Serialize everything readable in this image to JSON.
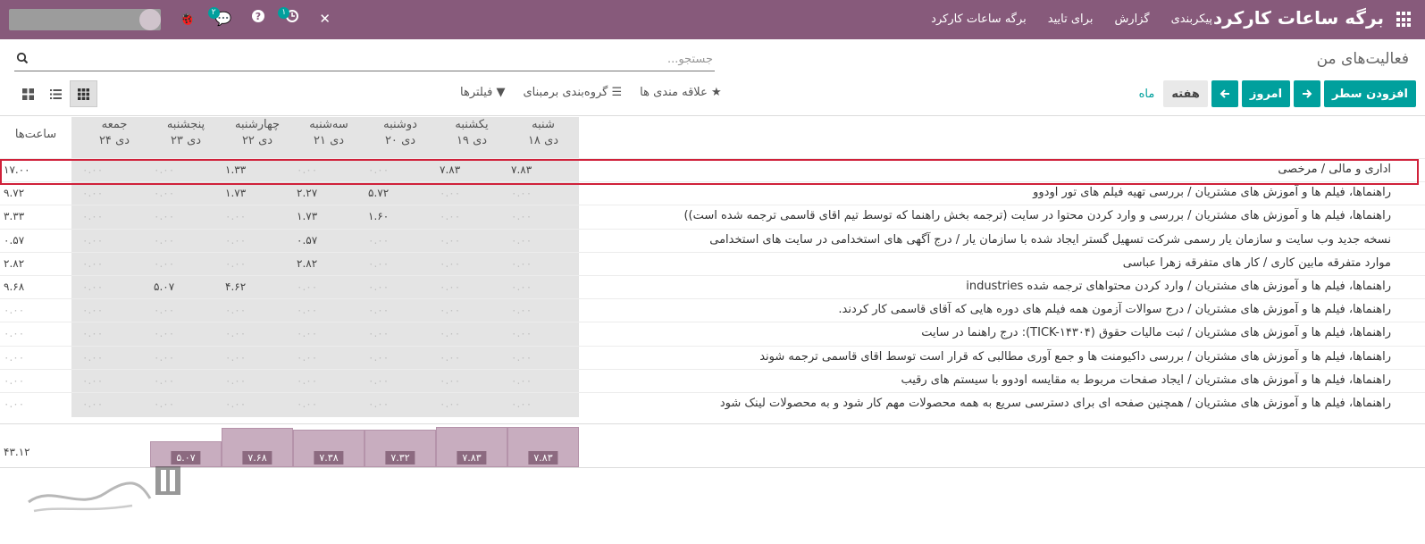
{
  "app": {
    "title": "برگه ساعات کارکرد",
    "menu": [
      "برگه ساعات کارکرد",
      "برای تایید",
      "گزارش",
      "پیکربندی"
    ],
    "systray": {
      "activity_badge": "۱",
      "messages_badge": "۲"
    }
  },
  "control": {
    "page_title": "فعالیت‌های من",
    "search_placeholder": "جستجو...",
    "buttons": {
      "add_line": "افزودن سطر",
      "today": "امروز",
      "week": "هفته",
      "month": "ماه"
    },
    "filters": {
      "filter": "فیلترها",
      "group_by": "گروه‌بندی برمبنای",
      "favorites": "علاقه مندی ها"
    }
  },
  "grid": {
    "hours_header": "ساعت‌ها",
    "days": [
      {
        "name": "شنبه",
        "date": "۱۸ دی"
      },
      {
        "name": "یکشنبه",
        "date": "۱۹ دی"
      },
      {
        "name": "دوشنبه",
        "date": "۲۰ دی"
      },
      {
        "name": "سه‌شنبه",
        "date": "۲۱ دی"
      },
      {
        "name": "چهارشنبه",
        "date": "۲۲ دی"
      },
      {
        "name": "پنجشنبه",
        "date": "۲۳ دی"
      },
      {
        "name": "جمعه",
        "date": "۲۴ دی"
      }
    ],
    "rows": [
      {
        "label": "اداری و مالی  /  مرخصی",
        "values": [
          "۷.۸۳",
          "۷.۸۳",
          "۰.۰۰",
          "۰.۰۰",
          "۱.۳۳",
          "۰.۰۰",
          "۰.۰۰"
        ],
        "total": "۱۷.۰۰"
      },
      {
        "label": "راهنماها، فیلم ها و آموزش های مشتریان  /  بررسی تهیه فیلم های تور اودوو",
        "values": [
          "۰.۰۰",
          "۰.۰۰",
          "۵.۷۲",
          "۲.۲۷",
          "۱.۷۳",
          "۰.۰۰",
          "۰.۰۰"
        ],
        "total": "۹.۷۲"
      },
      {
        "label": "راهنماها، فیلم ها و آموزش های مشتریان  /  بررسی و وارد کردن محتوا در سایت (ترجمه بخش راهنما که توسط تیم اقای قاسمی ترجمه شده است))",
        "values": [
          "۰.۰۰",
          "۰.۰۰",
          "۱.۶۰",
          "۱.۷۳",
          "۰.۰۰",
          "۰.۰۰",
          "۰.۰۰"
        ],
        "total": "۳.۳۳"
      },
      {
        "label": "نسخه جدید وب سایت و سازمان یار رسمی شرکت تسهیل گستر ایجاد شده با سازمان یار  /  درج آگهی های استخدامی در سایت های استخدامی",
        "values": [
          "۰.۰۰",
          "۰.۰۰",
          "۰.۰۰",
          "۰.۵۷",
          "۰.۰۰",
          "۰.۰۰",
          "۰.۰۰"
        ],
        "total": "۰.۵۷"
      },
      {
        "label": "موارد متفرقه مابین کاری  /  کار های متفرقه زهرا عباسی",
        "values": [
          "۰.۰۰",
          "۰.۰۰",
          "۰.۰۰",
          "۲.۸۲",
          "۰.۰۰",
          "۰.۰۰",
          "۰.۰۰"
        ],
        "total": "۲.۸۲"
      },
      {
        "label": "راهنماها، فیلم ها و آموزش های مشتریان  /  وارد کردن محتواهای ترجمه شده industries",
        "values": [
          "۰.۰۰",
          "۰.۰۰",
          "۰.۰۰",
          "۰.۰۰",
          "۴.۶۲",
          "۵.۰۷",
          "۰.۰۰"
        ],
        "total": "۹.۶۸"
      },
      {
        "label": "راهنماها، فیلم ها و آموزش های مشتریان  /  درج سوالات آزمون همه فیلم های دوره هایی که آقای قاسمی کار کردند.",
        "values": [
          "۰.۰۰",
          "۰.۰۰",
          "۰.۰۰",
          "۰.۰۰",
          "۰.۰۰",
          "۰.۰۰",
          "۰.۰۰"
        ],
        "total": "۰.۰۰"
      },
      {
        "label": "راهنماها، فیلم ها و آموزش های مشتریان  /  ثبت مالیات حقوق (TICK-۱۴۳۰۴): درج راهنما در سایت",
        "values": [
          "۰.۰۰",
          "۰.۰۰",
          "۰.۰۰",
          "۰.۰۰",
          "۰.۰۰",
          "۰.۰۰",
          "۰.۰۰"
        ],
        "total": "۰.۰۰"
      },
      {
        "label": "راهنماها، فیلم ها و آموزش های مشتریان  /  بررسی داکیومنت ها و جمع آوری مطالبی که قرار است توسط اقای قاسمی ترجمه شوند",
        "values": [
          "۰.۰۰",
          "۰.۰۰",
          "۰.۰۰",
          "۰.۰۰",
          "۰.۰۰",
          "۰.۰۰",
          "۰.۰۰"
        ],
        "total": "۰.۰۰"
      },
      {
        "label": "راهنماها، فیلم ها و آموزش های مشتریان  /  ایجاد صفحات مربوط به مقایسه اودوو با سیستم های رقیب",
        "values": [
          "۰.۰۰",
          "۰.۰۰",
          "۰.۰۰",
          "۰.۰۰",
          "۰.۰۰",
          "۰.۰۰",
          "۰.۰۰"
        ],
        "total": "۰.۰۰"
      },
      {
        "label": "راهنماها، فیلم ها و آموزش های مشتریان  /  همچنین صفحه ای برای دسترسی سریع به همه محصولات مهم کار شود و به محصولات لینک شود",
        "values": [
          "۰.۰۰",
          "۰.۰۰",
          "۰.۰۰",
          "۰.۰۰",
          "۰.۰۰",
          "۰.۰۰",
          "۰.۰۰"
        ],
        "total": "۰.۰۰"
      }
    ],
    "daily_totals": [
      {
        "label": "۷.۸۳",
        "value": 7.83
      },
      {
        "label": "۷.۸۳",
        "value": 7.83
      },
      {
        "label": "۷.۳۲",
        "value": 7.32
      },
      {
        "label": "۷.۳۸",
        "value": 7.38
      },
      {
        "label": "۷.۶۸",
        "value": 7.68
      },
      {
        "label": "۵.۰۷",
        "value": 5.07
      },
      {
        "label": "",
        "value": 0
      }
    ],
    "grand_total": "۴۳.۱۲"
  }
}
